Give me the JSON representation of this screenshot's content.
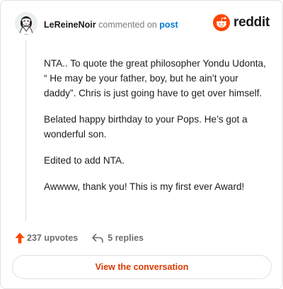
{
  "header": {
    "username": "LeReineNoir",
    "action_text": "commented on",
    "post_link": "post"
  },
  "logo": {
    "wordmark": "reddit",
    "icon": "reddit-snoo-icon",
    "color": "#ff4500"
  },
  "comment": {
    "paragraphs": [
      "NTA.. To quote the great philosopher Yondu Udonta, “ He may be your father, boy, but he ain’t your daddy”. Chris is just going have to get over himself.",
      "Belated happy birthday to your Pops. He’s got a wonderful son.",
      "Edited to add NTA.",
      "Awwww, thank you! This is my first ever Award!"
    ]
  },
  "actions": {
    "upvotes": "237 upvotes",
    "upvote_icon": "upvote-arrow-icon",
    "replies": "5 replies",
    "reply_icon": "reply-arrow-icon"
  },
  "cta": {
    "label": "View the conversation",
    "color": "#d93a00"
  }
}
